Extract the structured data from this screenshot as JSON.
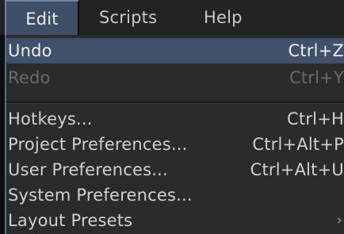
{
  "menubar": {
    "items": [
      {
        "label": "Edit",
        "active": true
      },
      {
        "label": "Scripts",
        "active": false
      },
      {
        "label": "Help",
        "active": false
      }
    ]
  },
  "edit_menu": {
    "items": [
      {
        "label": "Undo",
        "shortcut": "Ctrl+Z",
        "state": "highlighted"
      },
      {
        "label": "Redo",
        "shortcut": "Ctrl+Y",
        "state": "disabled"
      },
      {
        "label": "Hotkeys...",
        "shortcut": "Ctrl+H",
        "state": "normal"
      },
      {
        "label": "Project Preferences...",
        "shortcut": "Ctrl+Alt+P",
        "state": "normal"
      },
      {
        "label": "User Preferences...",
        "shortcut": "Ctrl+Alt+U",
        "state": "normal"
      },
      {
        "label": "System Preferences...",
        "shortcut": "",
        "state": "normal"
      },
      {
        "label": "Layout Presets",
        "shortcut": "",
        "state": "normal",
        "submenu_icon": "chevron-right-icon"
      }
    ]
  },
  "colors": {
    "menubar_bg": "#232323",
    "menu_bg": "#2b2b2b",
    "highlight_bg": "#3f506a",
    "text": "#d0d0d0",
    "disabled_text": "#6a6a6a"
  }
}
